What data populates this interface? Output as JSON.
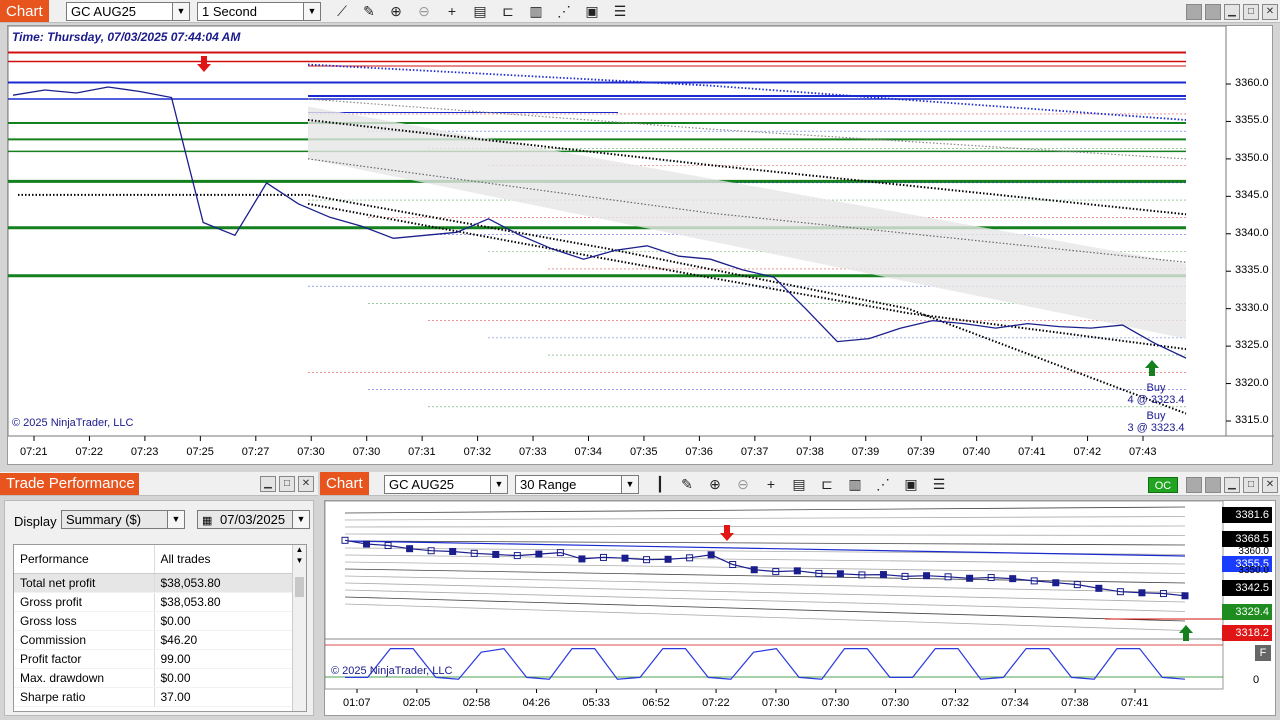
{
  "main_chart": {
    "tab_title": "Chart",
    "instrument": "GC AUG25",
    "interval": "1 Second",
    "timestamp": "Time: Thursday, 07/03/2025 07:44:04 AM",
    "copyright": "© 2025 NinjaTrader, LLC",
    "toolbar_icons": [
      "line-chart-icon",
      "pencil-icon",
      "zoom-in-icon",
      "zoom-out-icon",
      "crosshair-icon",
      "data-box-icon",
      "bar-type-icon",
      "indicators-icon",
      "strategies-icon",
      "templates-icon",
      "menu-icon"
    ],
    "y_axis_ticks": [
      "3360.0",
      "3355.0",
      "3350.0",
      "3345.0",
      "3340.0",
      "3335.0",
      "3330.0",
      "3325.0",
      "3320.0",
      "3315.0"
    ],
    "x_axis_ticks": [
      "07:21",
      "07:22",
      "07:23",
      "07:25",
      "07:27",
      "07:30",
      "07:30",
      "07:31",
      "07:32",
      "07:33",
      "07:34",
      "07:35",
      "07:36",
      "07:37",
      "07:38",
      "07:39",
      "07:39",
      "07:40",
      "07:41",
      "07:42",
      "07:43"
    ],
    "annotations": [
      {
        "label": "Buy",
        "detail": "4 @ 3323.4"
      },
      {
        "label": "Buy",
        "detail": "3 @ 3323.4"
      }
    ],
    "price_line": [
      3358.5,
      3359.2,
      3358.8,
      3359.6,
      3359.0,
      3358.2,
      3341.5,
      3339.8,
      3346.8,
      3344.0,
      3342.2,
      3341.0,
      3339.4,
      3339.8,
      3340.2,
      3342.0,
      3339.8,
      3338.0,
      3336.6,
      3337.8,
      3338.4,
      3337.0,
      3336.6,
      3335.2,
      3334.2,
      3330.0,
      3325.6,
      3326.0,
      3327.4,
      3328.4,
      3328.0,
      3327.4,
      3328.0,
      3327.6,
      3327.4,
      3327.8,
      3325.4,
      3323.4
    ]
  },
  "trade_performance": {
    "title": "Trade Performance",
    "display_label": "Display",
    "display_value": "Summary ($)",
    "date": "07/03/2025",
    "columns": [
      "Performance",
      "All trades"
    ],
    "rows": [
      [
        "Total net profit",
        "$38,053.80"
      ],
      [
        "Gross profit",
        "$38,053.80"
      ],
      [
        "Gross loss",
        "$0.00"
      ],
      [
        "Commission",
        "$46.20"
      ],
      [
        "Profit factor",
        "99.00"
      ],
      [
        "Max. drawdown",
        "$0.00"
      ],
      [
        "Sharpe ratio",
        "37.00"
      ]
    ]
  },
  "second_chart": {
    "tab_title": "Chart",
    "instrument": "GC AUG25",
    "interval": "30 Range",
    "oc_label": "OC",
    "copyright": "© 2025 NinjaTrader, LLC",
    "toolbar_icons": [
      "bar-chart-icon",
      "pencil-icon",
      "zoom-in-icon",
      "zoom-out-icon",
      "crosshair-icon",
      "data-box-icon",
      "bar-type-icon",
      "indicators-icon",
      "strategies-icon",
      "templates-icon",
      "menu-icon"
    ],
    "price_badges": [
      {
        "text": "3381.6",
        "color": "#000000"
      },
      {
        "text": "3368.5",
        "color": "#000000"
      },
      {
        "text": "3360.0",
        "color": "#000000"
      },
      {
        "text": "3355.5",
        "color": "#1a3cff"
      },
      {
        "text": "3350.0",
        "color": "#000000"
      },
      {
        "text": "3342.5",
        "color": "#000000"
      },
      {
        "text": "3329.4",
        "color": "#1e8c1e"
      },
      {
        "text": "3318.2",
        "color": "#e01515"
      }
    ],
    "osc_label": "0",
    "f_label": "F",
    "x_axis_ticks": [
      "01:07",
      "02:05",
      "02:58",
      "04:26",
      "05:33",
      "06:52",
      "07:22",
      "07:30",
      "07:30",
      "07:30",
      "07:32",
      "07:34",
      "07:38",
      "07:41"
    ],
    "price_line": [
      3368.0,
      3366.0,
      3365.2,
      3363.5,
      3362.4,
      3362.0,
      3361.0,
      3360.4,
      3359.8,
      3360.6,
      3361.4,
      3358.0,
      3358.8,
      3358.4,
      3357.6,
      3357.8,
      3358.6,
      3360.2,
      3355.0,
      3352.2,
      3351.2,
      3351.6,
      3350.2,
      3350.0,
      3349.4,
      3349.6,
      3348.6,
      3349.0,
      3348.4,
      3347.6,
      3348.0,
      3347.4,
      3346.2,
      3345.2,
      3344.2,
      3342.2,
      3340.4,
      3339.8,
      3339.4,
      3338.2
    ],
    "osc_values": [
      0.1,
      0.1,
      0.9,
      0.9,
      0.1,
      0.05,
      0.8,
      0.9,
      0.1,
      0.05,
      0.9,
      0.9,
      0.05,
      0.1,
      0.9,
      0.9,
      0.1,
      0.05,
      0.8,
      0.9,
      0.1,
      0.05,
      0.9,
      0.9,
      0.1,
      0.1,
      0.9,
      0.9,
      0.05,
      0.1,
      0.9,
      0.9,
      0.1,
      0.05,
      0.9,
      0.9,
      0.1,
      0.05
    ]
  }
}
